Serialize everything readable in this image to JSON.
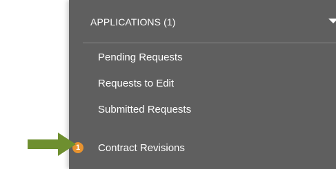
{
  "header": {
    "title": "APPLICATIONS (1)"
  },
  "menu": {
    "items": [
      {
        "label": "Pending Requests"
      },
      {
        "label": "Requests to Edit"
      },
      {
        "label": "Submitted Requests"
      },
      {
        "label": "Contract Revisions",
        "badge": "1"
      }
    ]
  },
  "colors": {
    "panel": "#5f5f5f",
    "badge": "#e8932f",
    "arrow": "#6e8f2f"
  },
  "annotation": {
    "arrow_icon": "right-arrow-icon"
  }
}
